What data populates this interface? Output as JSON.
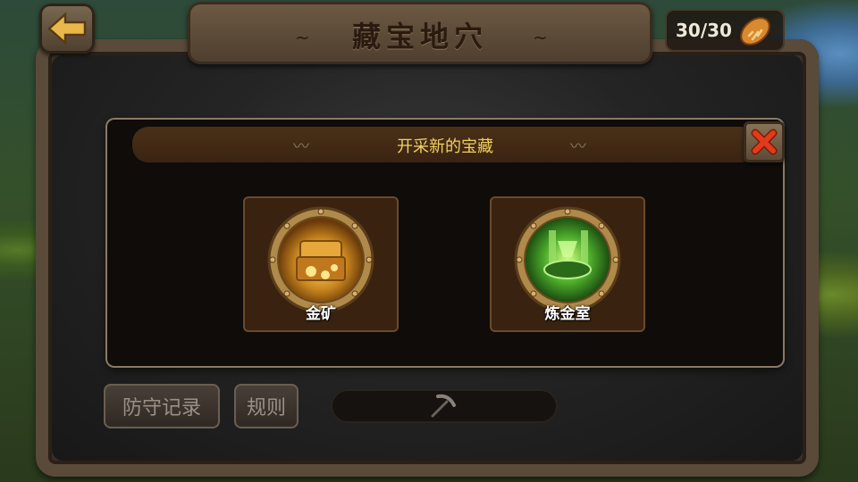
{
  "screen": {
    "title": "藏宝地穴",
    "title_swirl_left": "~",
    "title_swirl_right": "~"
  },
  "energy": {
    "count": "30/30",
    "icon": "bread-icon"
  },
  "dialog": {
    "title": "开采新的宝藏",
    "options": [
      {
        "label": "金矿",
        "icon": "gold-mine-icon"
      },
      {
        "label": "炼金室",
        "icon": "alchemy-room-icon"
      }
    ]
  },
  "buttons": {
    "defense_log": "防守记录",
    "rules": "规则"
  },
  "colors": {
    "title_gold": "#f2d060",
    "close_red": "#e23a1a",
    "back_arrow": "#e8b84a"
  }
}
